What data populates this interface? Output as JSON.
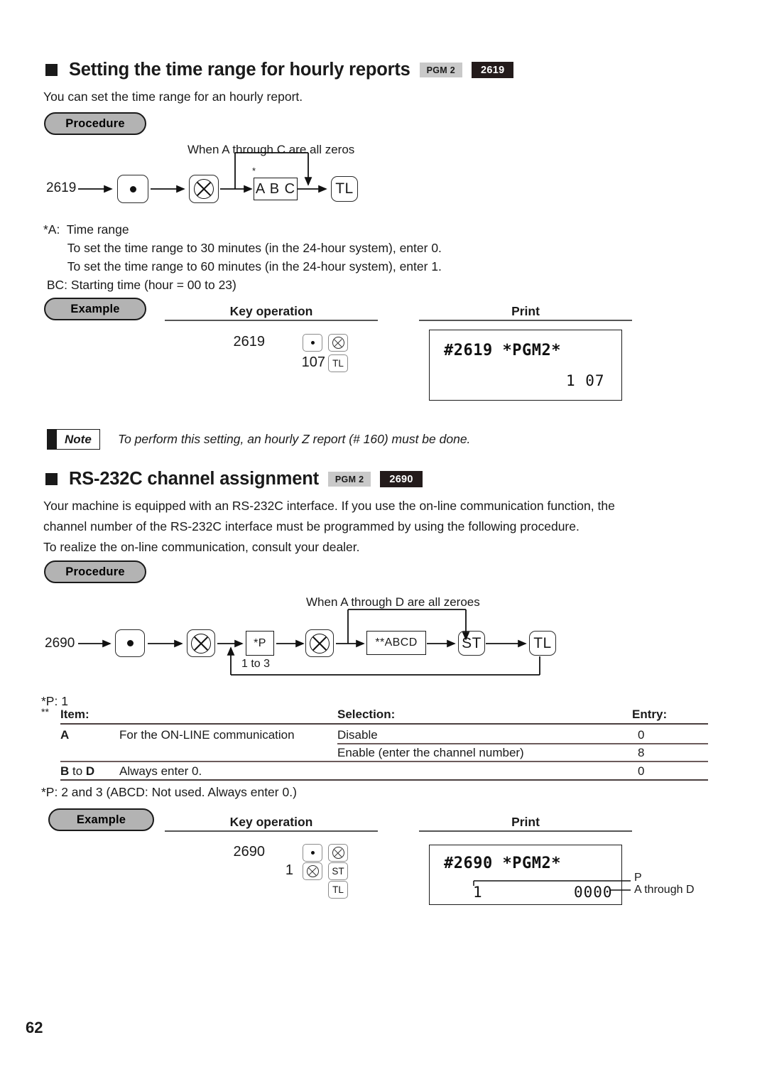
{
  "page": {
    "number": "62"
  },
  "section1": {
    "title": "Setting the time range for hourly reports",
    "badge_mode": "PGM 2",
    "badge_code": "2619",
    "intro": "You can set the time range for an hourly report.",
    "procedure_label": "Procedure",
    "diagram": {
      "start_code": "2619",
      "branch_note": "When A through C are all zeros",
      "key_dot": "•",
      "key_multiply": "⊗",
      "box_abc": "A B C",
      "abc_asterisk": "*",
      "key_tl": "TL"
    },
    "notes": [
      "*A:  Time range",
      "       To set the time range to 30 minutes (in the 24-hour system), enter 0.",
      "       To set the time range to 60 minutes (in the 24-hour system), enter 1.",
      " BC: Starting time (hour = 00 to 23)"
    ],
    "example": {
      "label": "Example",
      "key_operation_header": "Key operation",
      "print_header": "Print",
      "keyop_row1_num": "2619",
      "keyop_row1_key1": "•",
      "keyop_row1_key2": "⊗",
      "keyop_row2_num": "107",
      "keyop_row2_key1": "TL",
      "receipt_line1": "#2619 *PGM2*",
      "receipt_line2": "1 07"
    }
  },
  "note": {
    "label": "Note",
    "text": "To perform this setting, an hourly Z report (# 160) must be done."
  },
  "section2": {
    "title": "RS-232C channel assignment",
    "badge_mode": "PGM 2",
    "badge_code": "2690",
    "paragraph": [
      "Your machine is equipped with an RS-232C interface. If you use the on-line communication function, the",
      "channel number of the RS-232C interface must be programmed by using the following procedure.",
      "To realize the on-line communication, consult your dealer."
    ],
    "procedure_label": "Procedure",
    "diagram": {
      "start_code": "2690",
      "branch_note": "When A through D are all zeroes",
      "key_dot": "•",
      "key_multiply1": "⊗",
      "box_p": "*P",
      "loop_label": "1 to 3",
      "key_multiply2": "⊗",
      "box_abcd": "**ABCD",
      "key_st": "ST",
      "key_tl": "TL"
    },
    "p_note": "*P: 1",
    "double_aster": "**",
    "table": {
      "headers": [
        "Item:",
        "Selection:",
        "Entry:"
      ],
      "rows": [
        {
          "item": "A",
          "item_desc": "For the ON-LINE communication",
          "selection": "Disable",
          "entry": "0"
        },
        {
          "item": "",
          "item_desc": "",
          "selection": "Enable (enter the channel number)",
          "entry": "8"
        },
        {
          "item": "B to D",
          "item_bold_parts": [
            "B",
            " to ",
            "D"
          ],
          "item_desc": "Always enter 0.",
          "selection": "",
          "entry": "0"
        }
      ]
    },
    "p_note2": "*P: 2 and 3 (ABCD: Not used. Always enter 0.)",
    "example": {
      "label": "Example",
      "key_operation_header": "Key operation",
      "print_header": "Print",
      "keyop_row1_num": "2690",
      "keyop_row1_key1": "•",
      "keyop_row1_key2": "⊗",
      "keyop_row2_num": "1",
      "keyop_row2_key1": "⊗",
      "keyop_row2_key2": "ST",
      "keyop_row3_key1": "TL",
      "receipt_line1": "#2690 *PGM2*",
      "receipt_val_left": "1",
      "receipt_val_right": "0000",
      "callout_p": "P",
      "callout_abcd": "A through D"
    }
  }
}
